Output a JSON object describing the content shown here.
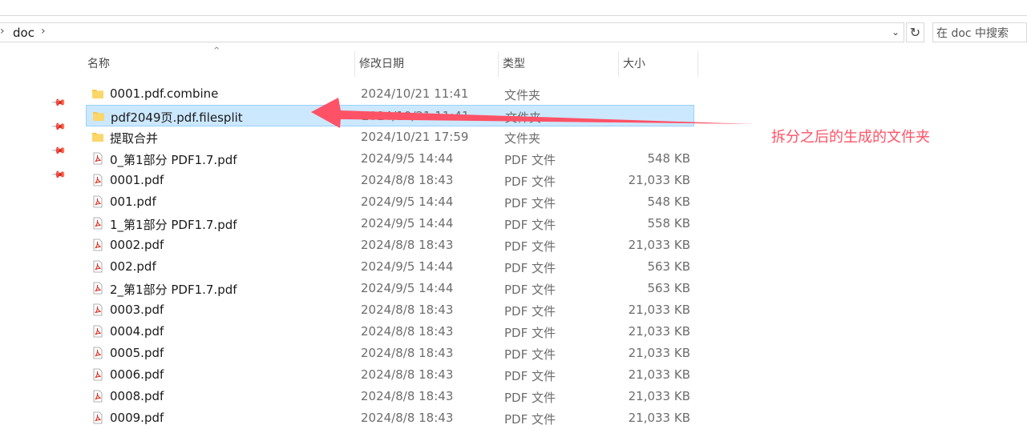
{
  "address": {
    "path": "doc",
    "chevron_left": "›",
    "chevron_right": "›",
    "dropdown": "⌄",
    "refresh": "↻"
  },
  "search": {
    "placeholder": "在 doc 中搜索"
  },
  "columns": {
    "name": "名称",
    "date": "修改日期",
    "type": "类型",
    "size": "大小",
    "sort_indicator": "^"
  },
  "files": [
    {
      "name": "0001.pdf.combine",
      "date": "2024/10/21 11:41",
      "type": "文件夹",
      "size": "",
      "icon": "folder-icon"
    },
    {
      "name": "pdf2049页.pdf.filesplit",
      "date": "2024/10/21 11:41",
      "type": "文件夹",
      "size": "",
      "icon": "folder-icon",
      "selected": true
    },
    {
      "name": "提取合并",
      "date": "2024/10/21 17:59",
      "type": "文件夹",
      "size": "",
      "icon": "folder-icon"
    },
    {
      "name": "0_第1部分 PDF1.7.pdf",
      "date": "2024/9/5 14:44",
      "type": "PDF 文件",
      "size": "548 KB",
      "icon": "pdf-icon"
    },
    {
      "name": "0001.pdf",
      "date": "2024/8/8 18:43",
      "type": "PDF 文件",
      "size": "21,033 KB",
      "icon": "pdf-icon"
    },
    {
      "name": "001.pdf",
      "date": "2024/9/5 14:44",
      "type": "PDF 文件",
      "size": "548 KB",
      "icon": "pdf-icon"
    },
    {
      "name": "1_第1部分 PDF1.7.pdf",
      "date": "2024/9/5 14:44",
      "type": "PDF 文件",
      "size": "558 KB",
      "icon": "pdf-icon"
    },
    {
      "name": "0002.pdf",
      "date": "2024/8/8 18:43",
      "type": "PDF 文件",
      "size": "21,033 KB",
      "icon": "pdf-icon"
    },
    {
      "name": "002.pdf",
      "date": "2024/9/5 14:44",
      "type": "PDF 文件",
      "size": "563 KB",
      "icon": "pdf-icon"
    },
    {
      "name": "2_第1部分 PDF1.7.pdf",
      "date": "2024/9/5 14:44",
      "type": "PDF 文件",
      "size": "563 KB",
      "icon": "pdf-icon"
    },
    {
      "name": "0003.pdf",
      "date": "2024/8/8 18:43",
      "type": "PDF 文件",
      "size": "21,033 KB",
      "icon": "pdf-icon"
    },
    {
      "name": "0004.pdf",
      "date": "2024/8/8 18:43",
      "type": "PDF 文件",
      "size": "21,033 KB",
      "icon": "pdf-icon"
    },
    {
      "name": "0005.pdf",
      "date": "2024/8/8 18:43",
      "type": "PDF 文件",
      "size": "21,033 KB",
      "icon": "pdf-icon"
    },
    {
      "name": "0006.pdf",
      "date": "2024/8/8 18:43",
      "type": "PDF 文件",
      "size": "21,033 KB",
      "icon": "pdf-icon"
    },
    {
      "name": "0008.pdf",
      "date": "2024/8/8 18:43",
      "type": "PDF 文件",
      "size": "21,033 KB",
      "icon": "pdf-icon"
    },
    {
      "name": "0009.pdf",
      "date": "2024/8/8 18:43",
      "type": "PDF 文件",
      "size": "21,033 KB",
      "icon": "pdf-icon"
    }
  ],
  "annotation": {
    "text": "拆分之后的生成的文件夹",
    "color": "#ff5266"
  },
  "colors": {
    "selection": "#cce8ff",
    "folder": "#f8c848",
    "pdf": "#d9261c"
  }
}
